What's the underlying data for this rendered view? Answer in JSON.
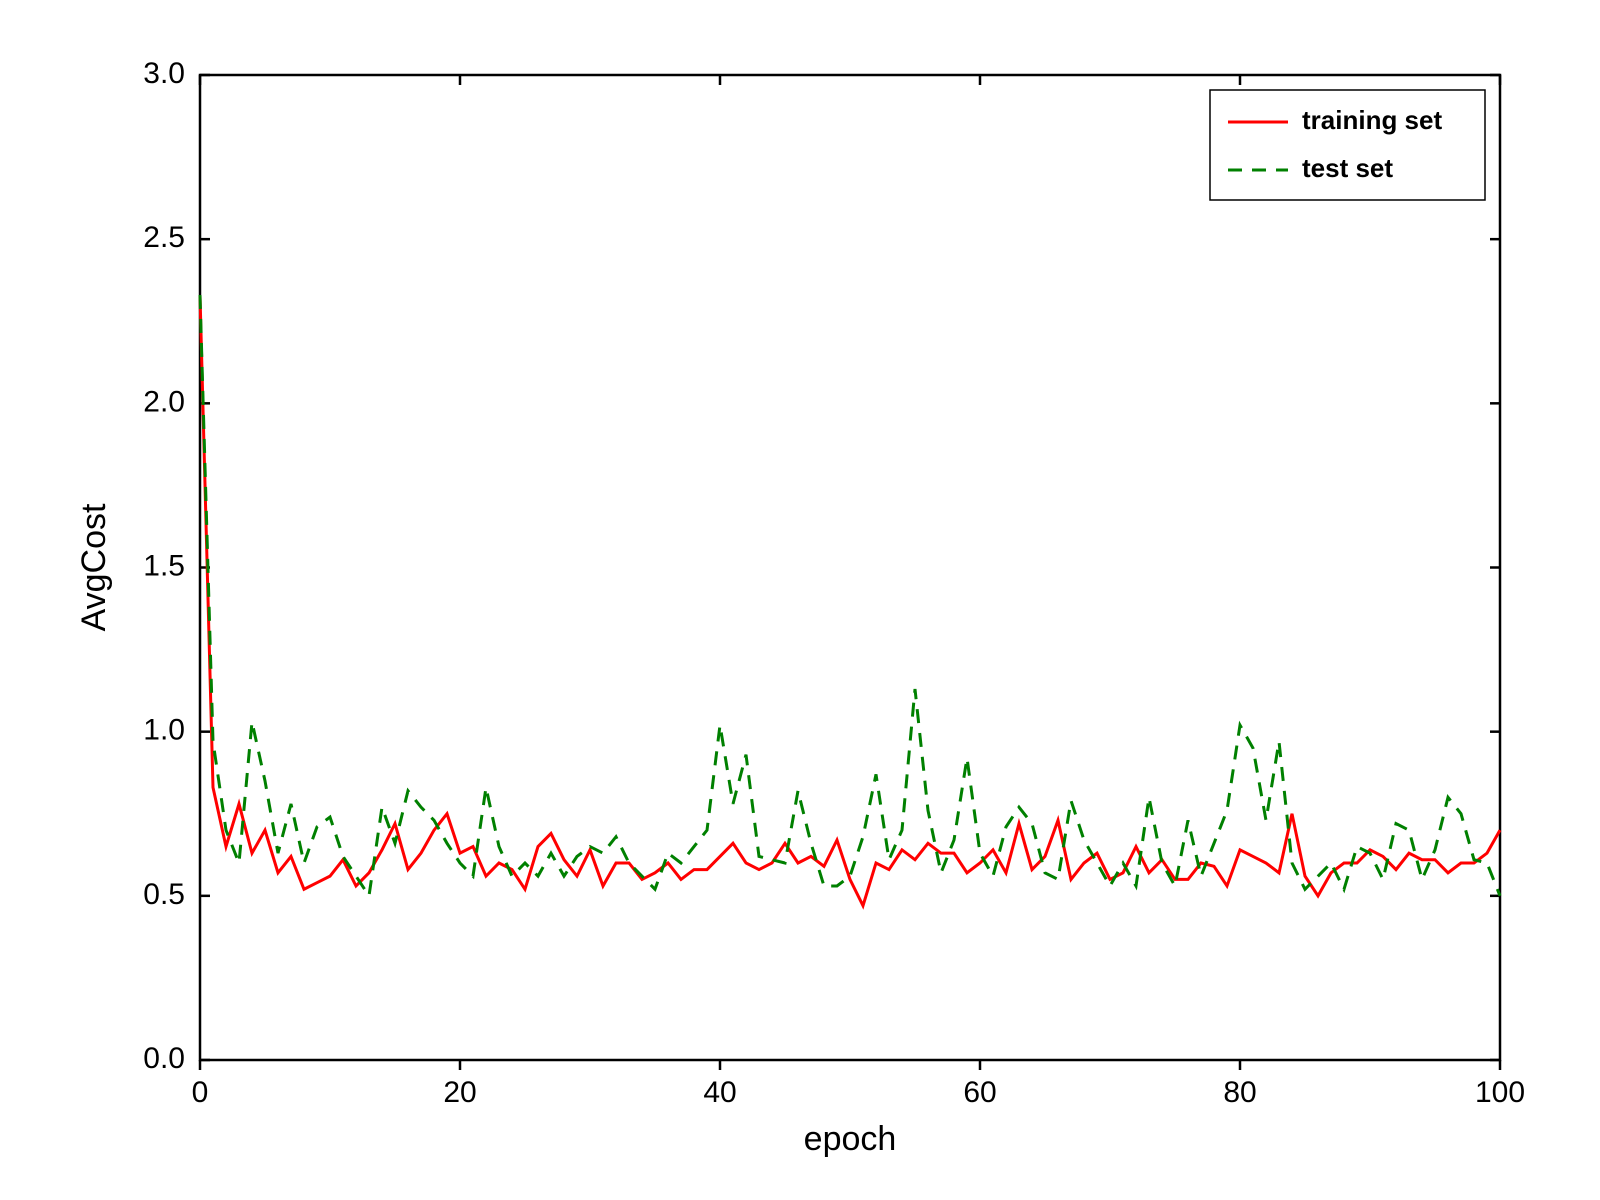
{
  "chart_data": {
    "type": "line",
    "xlabel": "epoch",
    "ylabel": "AvgCost",
    "xlim": [
      0,
      100
    ],
    "ylim": [
      0,
      3
    ],
    "x_ticks": [
      0,
      20,
      40,
      60,
      80,
      100
    ],
    "y_ticks": [
      0.0,
      0.5,
      1.0,
      1.5,
      2.0,
      2.5,
      3.0
    ],
    "x": [
      0,
      1,
      2,
      3,
      4,
      5,
      6,
      7,
      8,
      9,
      10,
      11,
      12,
      13,
      14,
      15,
      16,
      17,
      18,
      19,
      20,
      21,
      22,
      23,
      24,
      25,
      26,
      27,
      28,
      29,
      30,
      31,
      32,
      33,
      34,
      35,
      36,
      37,
      38,
      39,
      40,
      41,
      42,
      43,
      44,
      45,
      46,
      47,
      48,
      49,
      50,
      51,
      52,
      53,
      54,
      55,
      56,
      57,
      58,
      59,
      60,
      61,
      62,
      63,
      64,
      65,
      66,
      67,
      68,
      69,
      70,
      71,
      72,
      73,
      74,
      75,
      76,
      77,
      78,
      79,
      80,
      81,
      82,
      83,
      84,
      85,
      86,
      87,
      88,
      89,
      90,
      91,
      92,
      93,
      94,
      95,
      96,
      97,
      98,
      99,
      100
    ],
    "series": [
      {
        "name": "training set",
        "color": "#ff0000",
        "dash": "solid",
        "values": [
          2.33,
          0.83,
          0.65,
          0.78,
          0.63,
          0.7,
          0.57,
          0.62,
          0.52,
          0.54,
          0.56,
          0.61,
          0.53,
          0.57,
          0.64,
          0.72,
          0.58,
          0.63,
          0.7,
          0.75,
          0.63,
          0.65,
          0.56,
          0.6,
          0.58,
          0.52,
          0.65,
          0.69,
          0.61,
          0.56,
          0.64,
          0.53,
          0.6,
          0.6,
          0.55,
          0.57,
          0.6,
          0.55,
          0.58,
          0.58,
          0.62,
          0.66,
          0.6,
          0.58,
          0.6,
          0.66,
          0.6,
          0.62,
          0.59,
          0.67,
          0.55,
          0.47,
          0.6,
          0.58,
          0.64,
          0.61,
          0.66,
          0.63,
          0.63,
          0.57,
          0.6,
          0.64,
          0.57,
          0.72,
          0.58,
          0.62,
          0.73,
          0.55,
          0.6,
          0.63,
          0.55,
          0.57,
          0.65,
          0.57,
          0.61,
          0.55,
          0.55,
          0.6,
          0.59,
          0.53,
          0.64,
          0.62,
          0.6,
          0.57,
          0.75,
          0.56,
          0.5,
          0.57,
          0.6,
          0.6,
          0.64,
          0.62,
          0.58,
          0.63,
          0.61,
          0.61,
          0.57,
          0.6,
          0.6,
          0.63,
          0.7
        ]
      },
      {
        "name": "test set",
        "color": "#008000",
        "dash": "dashed",
        "values": [
          2.33,
          0.97,
          0.7,
          0.6,
          1.03,
          0.85,
          0.63,
          0.78,
          0.6,
          0.71,
          0.74,
          0.62,
          0.56,
          0.5,
          0.77,
          0.66,
          0.82,
          0.77,
          0.73,
          0.66,
          0.6,
          0.56,
          0.83,
          0.65,
          0.56,
          0.6,
          0.56,
          0.63,
          0.56,
          0.62,
          0.65,
          0.63,
          0.68,
          0.6,
          0.56,
          0.52,
          0.63,
          0.6,
          0.65,
          0.7,
          1.02,
          0.78,
          0.93,
          0.62,
          0.61,
          0.6,
          0.82,
          0.66,
          0.53,
          0.53,
          0.56,
          0.68,
          0.87,
          0.61,
          0.7,
          1.13,
          0.76,
          0.57,
          0.67,
          0.92,
          0.63,
          0.56,
          0.71,
          0.77,
          0.72,
          0.57,
          0.55,
          0.79,
          0.67,
          0.6,
          0.53,
          0.6,
          0.53,
          0.8,
          0.6,
          0.53,
          0.73,
          0.56,
          0.66,
          0.76,
          1.02,
          0.95,
          0.73,
          0.97,
          0.6,
          0.52,
          0.56,
          0.6,
          0.52,
          0.65,
          0.63,
          0.55,
          0.72,
          0.7,
          0.55,
          0.64,
          0.8,
          0.75,
          0.61,
          0.6,
          0.5
        ]
      }
    ],
    "legend": {
      "position": "upper right",
      "entries": [
        "training set",
        "test set"
      ]
    }
  }
}
